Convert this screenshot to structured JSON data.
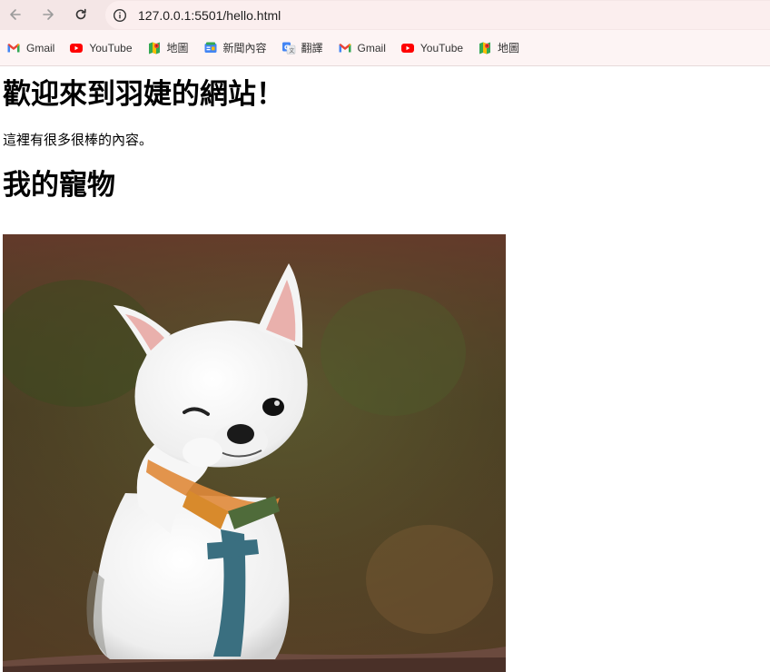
{
  "browser": {
    "url": "127.0.0.1:5501/hello.html",
    "bookmarks": [
      {
        "label": "Gmail",
        "icon": "gmail-icon"
      },
      {
        "label": "YouTube",
        "icon": "youtube-icon"
      },
      {
        "label": "地圖",
        "icon": "maps-icon"
      },
      {
        "label": "新聞內容",
        "icon": "news-icon"
      },
      {
        "label": "翻譯",
        "icon": "translate-icon"
      },
      {
        "label": "Gmail",
        "icon": "gmail-icon"
      },
      {
        "label": "YouTube",
        "icon": "youtube-icon"
      },
      {
        "label": "地圖",
        "icon": "maps-icon"
      }
    ]
  },
  "page": {
    "title": "歡迎來到羽婕的網站！",
    "intro": "這裡有很多很棒的內容。",
    "pets_heading": "我的寵物",
    "pet_image": "white-chihuahua-photo"
  },
  "colors": {
    "toolbar_bg": "#f4e6e6",
    "bookmarks_bg": "#fdf4f4",
    "youtube_red": "#ff0000"
  }
}
